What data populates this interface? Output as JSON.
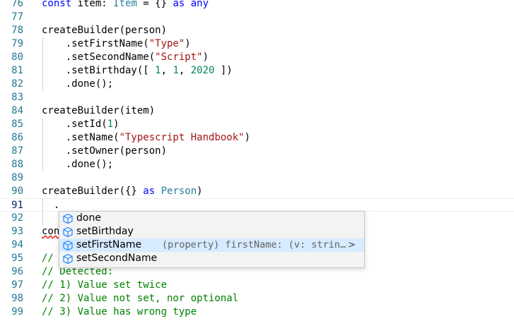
{
  "lines": [
    {
      "num": "76",
      "tokens": [
        [
          "kw",
          "const "
        ],
        [
          "",
          "item: "
        ],
        [
          "ty",
          "Item"
        ],
        [
          "",
          " = {} "
        ],
        [
          "kw",
          "as "
        ],
        [
          "kw",
          "any"
        ]
      ]
    },
    {
      "num": "77",
      "tokens": []
    },
    {
      "num": "78",
      "tokens": [
        [
          "",
          "createBuilder(person)"
        ]
      ]
    },
    {
      "num": "79",
      "tokens": [
        [
          "",
          "    .setFirstName("
        ],
        [
          "str",
          "\"Type\""
        ],
        [
          "",
          ")"
        ]
      ]
    },
    {
      "num": "80",
      "tokens": [
        [
          "",
          "    .setSecondName("
        ],
        [
          "str",
          "\"Script\""
        ],
        [
          "",
          ")"
        ]
      ]
    },
    {
      "num": "81",
      "tokens": [
        [
          "",
          "    .setBirthday([ "
        ],
        [
          "num",
          "1"
        ],
        [
          "",
          ", "
        ],
        [
          "num",
          "1"
        ],
        [
          "",
          ", "
        ],
        [
          "num",
          "2020"
        ],
        [
          "",
          " ])"
        ]
      ]
    },
    {
      "num": "82",
      "tokens": [
        [
          "",
          "    .done();"
        ]
      ]
    },
    {
      "num": "83",
      "tokens": []
    },
    {
      "num": "84",
      "tokens": [
        [
          "",
          "createBuilder(item)"
        ]
      ]
    },
    {
      "num": "85",
      "tokens": [
        [
          "",
          "    .setId("
        ],
        [
          "num",
          "1"
        ],
        [
          "",
          ")"
        ]
      ]
    },
    {
      "num": "86",
      "tokens": [
        [
          "",
          "    .setName("
        ],
        [
          "str",
          "\"Typescript Handbook\""
        ],
        [
          "",
          ")"
        ]
      ]
    },
    {
      "num": "87",
      "tokens": [
        [
          "",
          "    .setOwner(person)"
        ]
      ]
    },
    {
      "num": "88",
      "tokens": [
        [
          "",
          "    .done();"
        ]
      ]
    },
    {
      "num": "89",
      "tokens": []
    },
    {
      "num": "90",
      "tokens": [
        [
          "",
          "createBuilder({} "
        ],
        [
          "kw",
          "as "
        ],
        [
          "ty",
          "Person"
        ],
        [
          "",
          ")"
        ]
      ]
    },
    {
      "num": "91",
      "tokens": [
        [
          "",
          "  ."
        ]
      ],
      "current": true
    },
    {
      "num": "92",
      "tokens": []
    },
    {
      "num": "93",
      "tokens": [
        [
          "sq",
          "con"
        ]
      ]
    },
    {
      "num": "94",
      "tokens": []
    },
    {
      "num": "95",
      "tokens": [
        [
          "cm",
          "// "
        ]
      ]
    },
    {
      "num": "96",
      "tokens": [
        [
          "cm",
          "// Detected:"
        ]
      ]
    },
    {
      "num": "97",
      "tokens": [
        [
          "cm",
          "// 1) Value set twice"
        ]
      ]
    },
    {
      "num": "98",
      "tokens": [
        [
          "cm",
          "// 2) Value not set, nor optional"
        ]
      ]
    },
    {
      "num": "99",
      "tokens": [
        [
          "cm",
          "// 3) Value has wrong type"
        ]
      ]
    }
  ],
  "suggestions": [
    {
      "label": "done",
      "icon": "property-icon"
    },
    {
      "label": "setBirthday",
      "icon": "property-icon"
    },
    {
      "label": "setFirstName",
      "icon": "property-icon",
      "detail": "(property) firstName: (v: strin…",
      "more": ">",
      "selected": true
    },
    {
      "label": "setSecondName",
      "icon": "property-icon"
    }
  ],
  "colors": {
    "keyword": "#0000ff",
    "type": "#267f99",
    "string": "#a31515",
    "number": "#098658",
    "comment": "#008000",
    "line_number": "#237893",
    "suggest_selected": "#d6ebff",
    "property_icon": "#1a85ff"
  }
}
